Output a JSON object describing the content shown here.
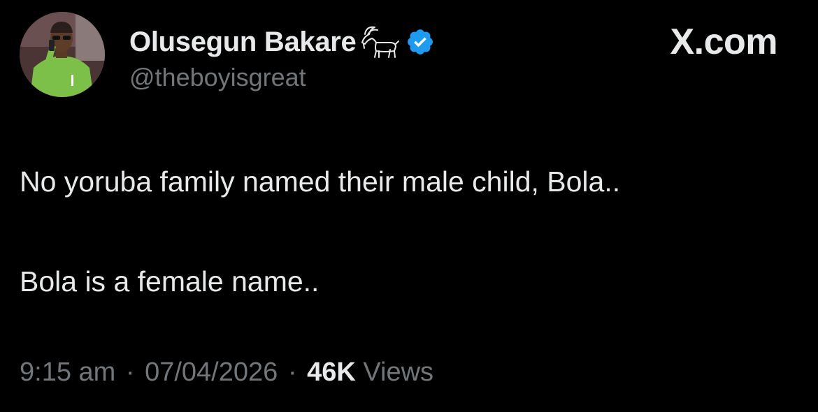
{
  "header": {
    "display_name": "Olusegun Bakare",
    "handle": "@theboyisgreat",
    "brand": "X.com",
    "badge_icon": "goat-icon",
    "verified_icon": "verified-badge-icon",
    "verified_color": "#1d9bf0"
  },
  "tweet": {
    "paragraphs": [
      "No yoruba family named their male child, Bola..",
      "Bola is a female name.."
    ]
  },
  "meta": {
    "time": "9:15 am",
    "separator": "·",
    "date": "07/04/2026",
    "views_count": "46K",
    "views_label": "Views"
  },
  "colors": {
    "background": "#000000",
    "text_primary": "#e7e9ea",
    "text_secondary": "#71767b",
    "accent": "#1d9bf0"
  }
}
